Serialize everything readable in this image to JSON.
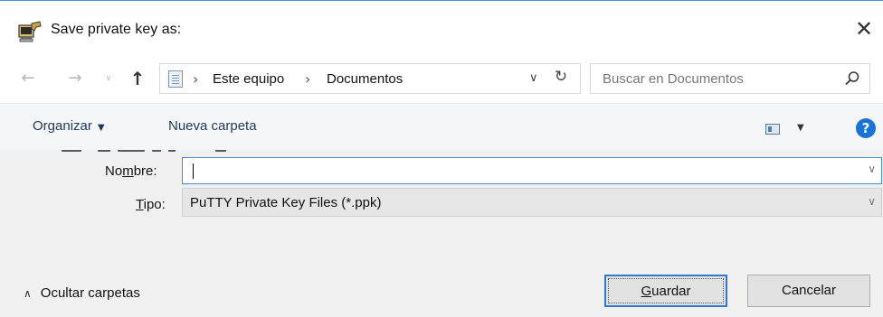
{
  "window": {
    "title": "Save private key as:",
    "close_glyph": "✕",
    "app_icon": "putty-icon"
  },
  "navigation": {
    "back_glyph": "←",
    "forward_glyph": "→",
    "recent_glyph": "∨",
    "up_glyph": "↑",
    "breadcrumbs": [
      "Este equipo",
      "Documentos"
    ],
    "breadcrumb_separator": "›",
    "dropdown_glyph": "∨",
    "refresh_glyph": "↻"
  },
  "search": {
    "placeholder": "Buscar en Documentos"
  },
  "toolbar": {
    "organize_label": "Organizar",
    "organize_caret": "▼",
    "new_folder_label": "Nueva carpeta",
    "view_caret": "▼",
    "help_glyph": "?"
  },
  "form": {
    "name_label_before": "No",
    "name_label_mnemonic": "m",
    "name_label_after": "bre:",
    "name_value": "",
    "name_dropdown_glyph": "∨",
    "type_label_mnemonic": "T",
    "type_label_after": "ipo:",
    "type_value": "PuTTY Private Key Files (*.ppk)",
    "type_dropdown_glyph": "∨"
  },
  "footer": {
    "hide_folders_glyph": "∧",
    "hide_folders_label": "Ocultar carpetas",
    "save_mnemonic": "G",
    "save_label_rest": "uardar",
    "cancel_label": "Cancelar"
  },
  "colors": {
    "accent": "#2f79cf",
    "toolbar_text": "#1e395b",
    "help_blue": "#1a73d9",
    "form_background": "#f0f0f0"
  }
}
